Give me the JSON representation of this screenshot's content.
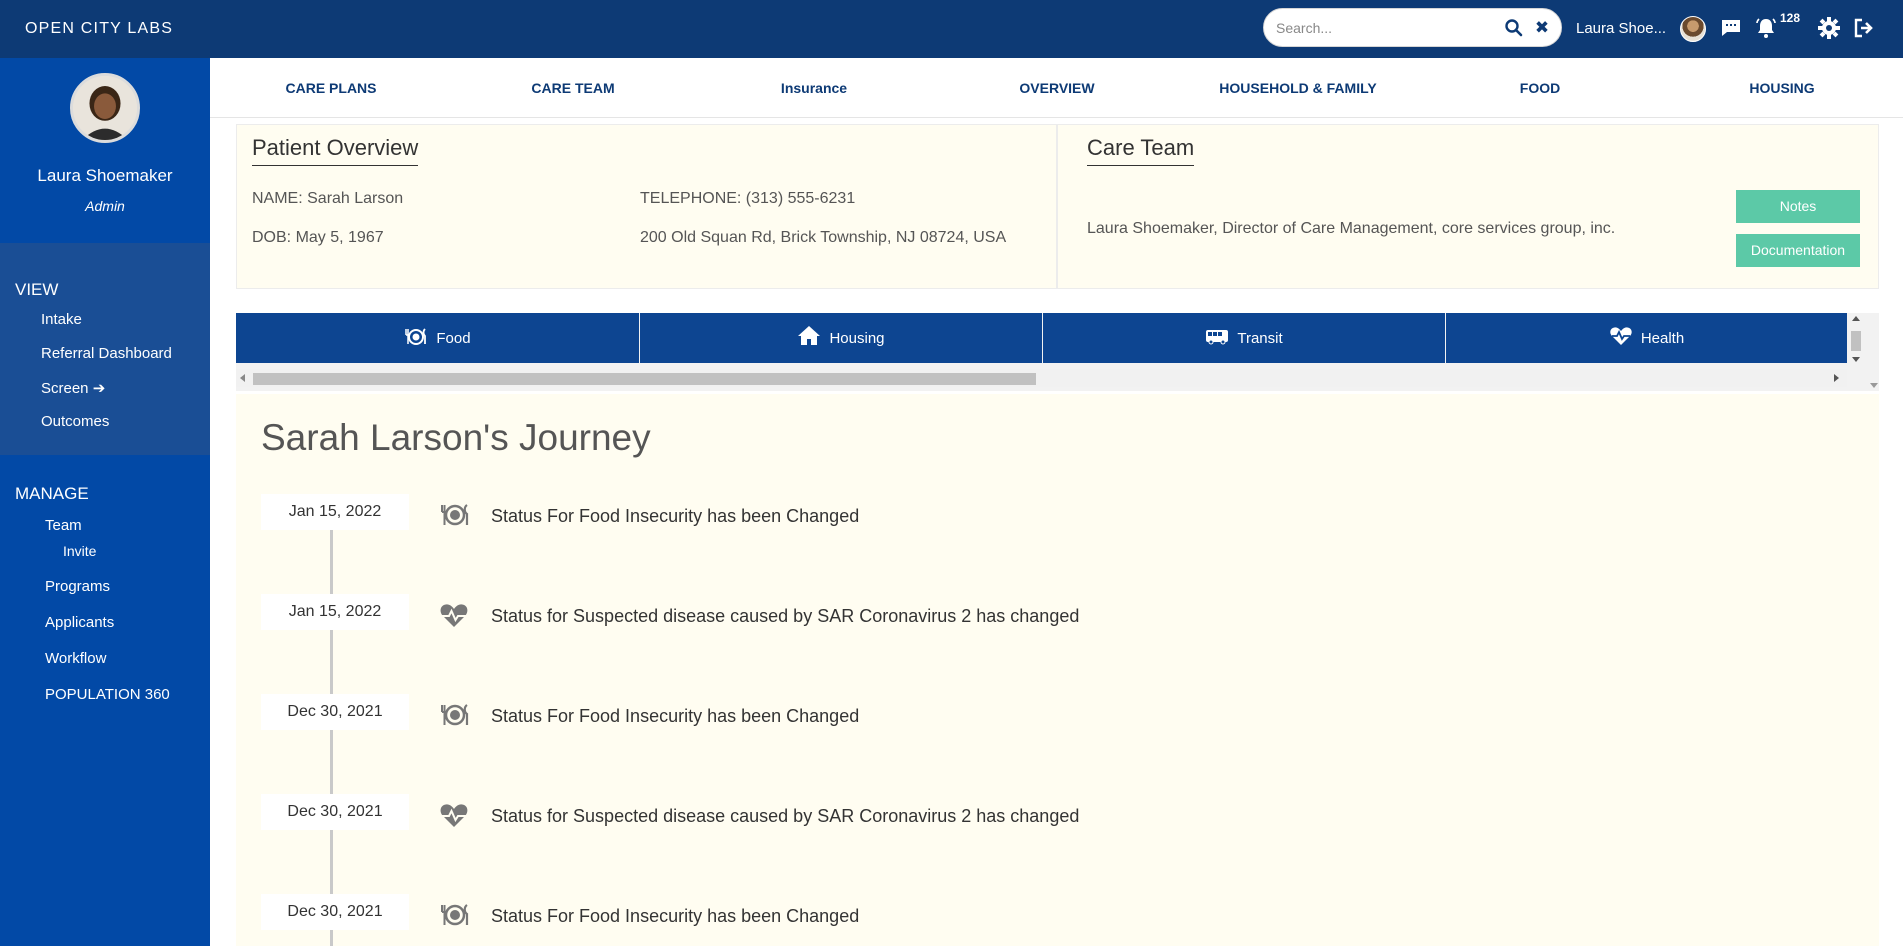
{
  "header": {
    "brand": "OPEN CITY LABS",
    "search_placeholder": "Search...",
    "user_name": "Laura Shoe...",
    "notification_count": "128",
    "icons": [
      "search-icon",
      "close-icon",
      "avatar",
      "chat-icon",
      "bell-icon",
      "gear-icon",
      "logout-icon"
    ]
  },
  "sidebar": {
    "profile": {
      "name": "Laura Shoemaker",
      "role": "Admin"
    },
    "view": {
      "title": "VIEW",
      "items": [
        "Intake",
        "Referral Dashboard",
        "Screen",
        "Outcomes"
      ]
    },
    "manage": {
      "title": "MANAGE",
      "items": [
        "Team",
        "Invite",
        "Programs",
        "Applicants",
        "Workflow",
        "POPULATION 360"
      ]
    }
  },
  "tabs": [
    "CARE PLANS",
    "CARE TEAM",
    "Insurance",
    "OVERVIEW",
    "HOUSEHOLD & FAMILY",
    "FOOD",
    "HOUSING"
  ],
  "patient_overview": {
    "title": "Patient Overview",
    "name": "NAME: Sarah Larson",
    "dob": "DOB: May 5, 1967",
    "telephone": "TELEPHONE: (313) 555-6231",
    "address": "200 Old Squan Rd, Brick Township, NJ 08724, USA"
  },
  "care_team": {
    "title": "Care Team",
    "member": "Laura Shoemaker, Director of Care Management, core services group, inc.",
    "notes_label": "Notes",
    "documentation_label": "Documentation"
  },
  "categories": [
    {
      "label": "Food",
      "icon": "food-icon"
    },
    {
      "label": "Housing",
      "icon": "home-icon"
    },
    {
      "label": "Transit",
      "icon": "bus-icon"
    },
    {
      "label": "Health",
      "icon": "heart-pulse-icon"
    }
  ],
  "journey": {
    "title": "Sarah Larson's Journey",
    "events": [
      {
        "date": "Jan 15, 2022",
        "icon": "food-icon",
        "text": "Status For Food Insecurity has been Changed"
      },
      {
        "date": "Jan 15, 2022",
        "icon": "heart-pulse-icon",
        "text": "Status for Suspected disease caused by SAR Coronavirus 2 has changed"
      },
      {
        "date": "Dec 30, 2021",
        "icon": "food-icon",
        "text": "Status For Food Insecurity has been Changed"
      },
      {
        "date": "Dec 30, 2021",
        "icon": "heart-pulse-icon",
        "text": "Status for Suspected disease caused by SAR Coronavirus 2 has changed"
      },
      {
        "date": "Dec 30, 2021",
        "icon": "food-icon",
        "text": "Status For Food Insecurity has been Changed"
      }
    ]
  }
}
